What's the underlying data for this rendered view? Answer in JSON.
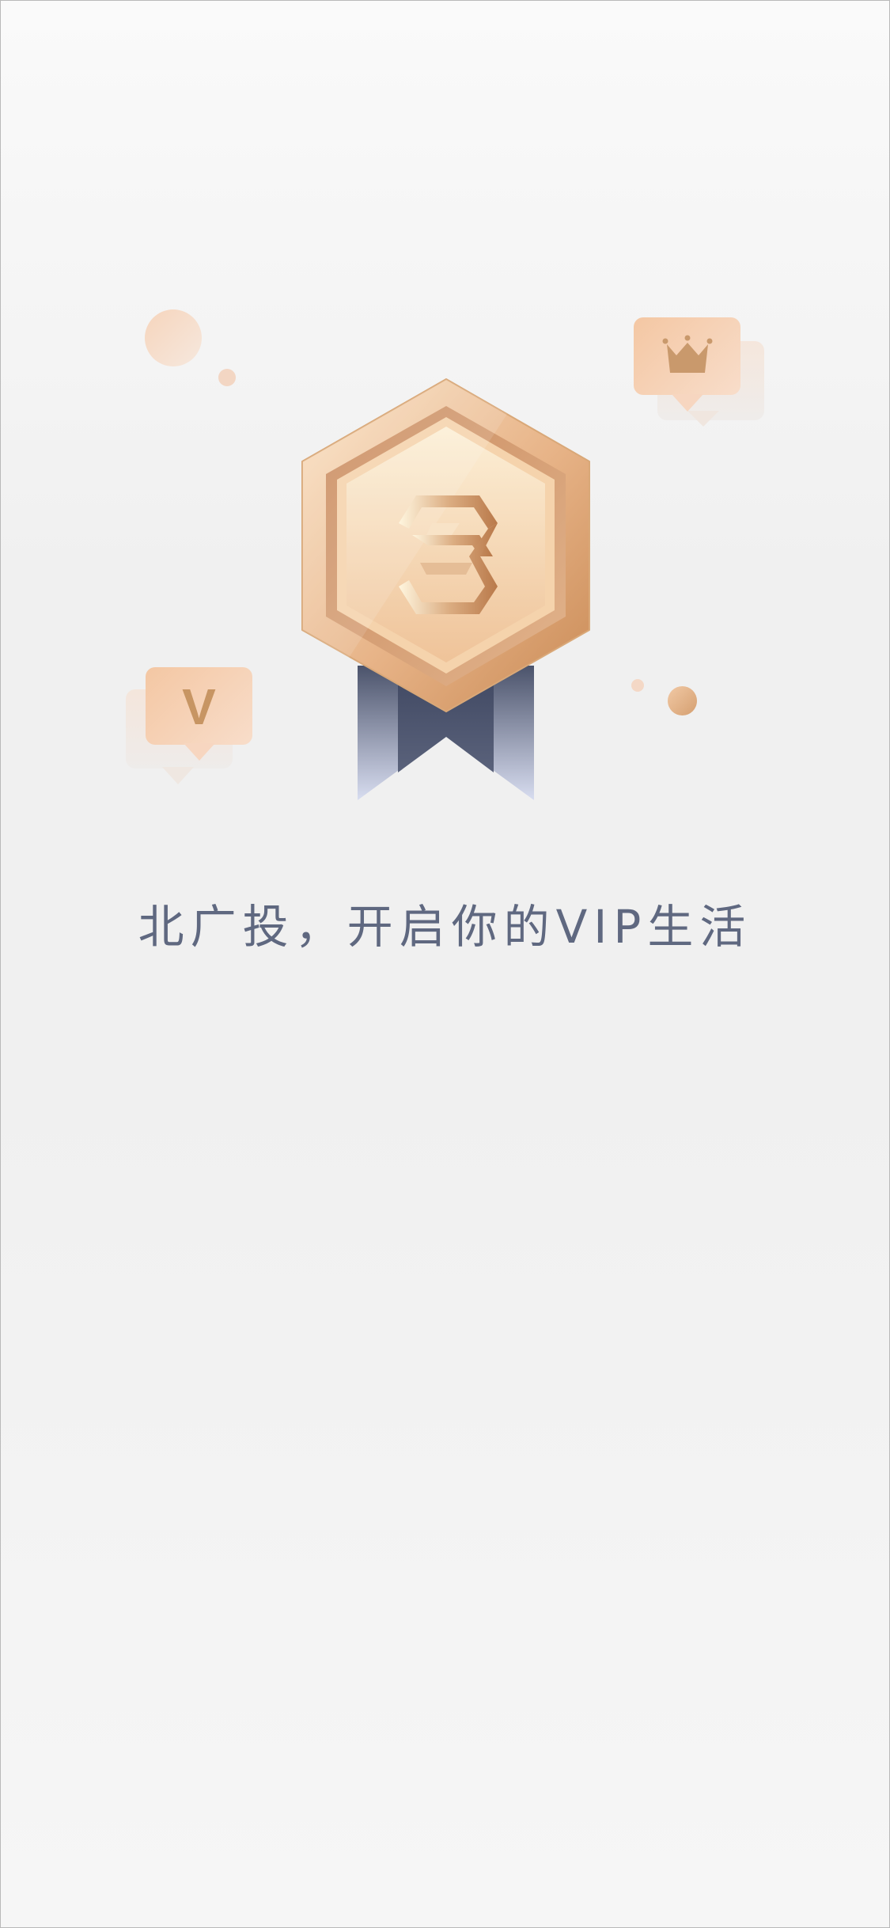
{
  "screen": {
    "headline": "北广投，开启你的VIP生活"
  },
  "badges": {
    "v_tag_letter": "V"
  },
  "icons": {
    "medal": "medal-icon",
    "crown": "crown-icon",
    "logo": "brand-logo-icon"
  },
  "colors": {
    "headline": "#5f6880",
    "accent_gold": "#d4a27a",
    "ribbon_dark": "#4e566d"
  }
}
